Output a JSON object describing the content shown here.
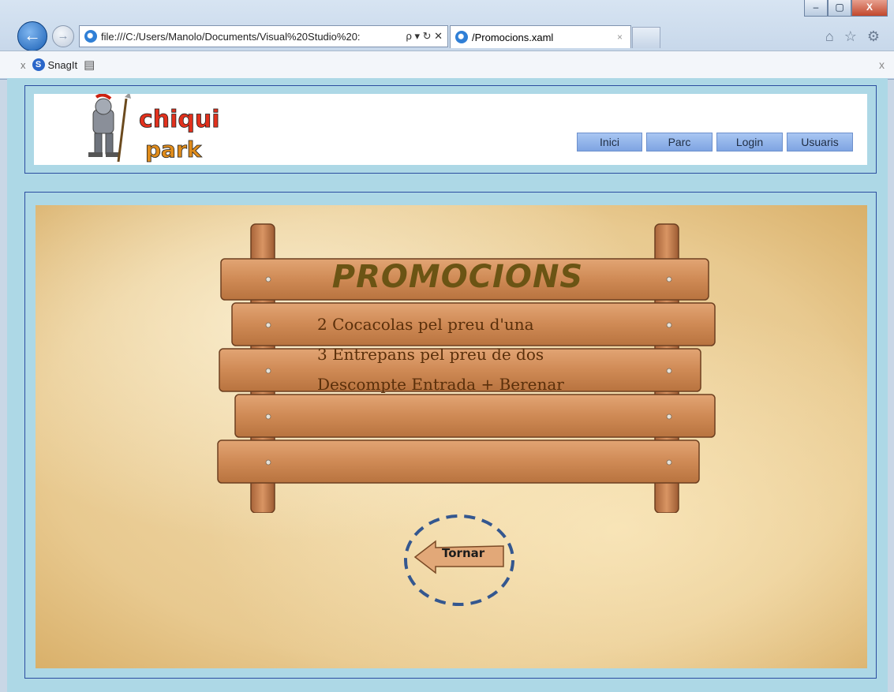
{
  "browser": {
    "window_controls": [
      "–",
      "▢",
      "X"
    ],
    "address": "file:///C:/Users/Manolo/Documents/Visual%20Studio%20:",
    "address_tools": "ρ ▾ ↻ ✕",
    "tab_title": "/Promocions.xaml",
    "tab_close": "×",
    "toolbar_close": "x",
    "snagit_label": "SnagIt",
    "toolbar_right_close": "x",
    "right_icons": "⌂ ☆ ⚙"
  },
  "site": {
    "logo_text_top": "chiqui",
    "logo_text_bottom": "park",
    "nav": [
      "Inici",
      "Parc",
      "Login",
      "Usuaris"
    ]
  },
  "promotions": {
    "title": "PROMOCIONS",
    "items": [
      "2 Cocacolas pel preu d'una",
      "3 Entrepans pel preu de dos",
      "Descompte Entrada + Berenar"
    ],
    "back_button": "Tornar"
  },
  "colors": {
    "nav_button": "#7ea4e2",
    "page_background": "#add8e6",
    "frame_border": "#2b4da0",
    "highlight_circle": "#34578f"
  }
}
